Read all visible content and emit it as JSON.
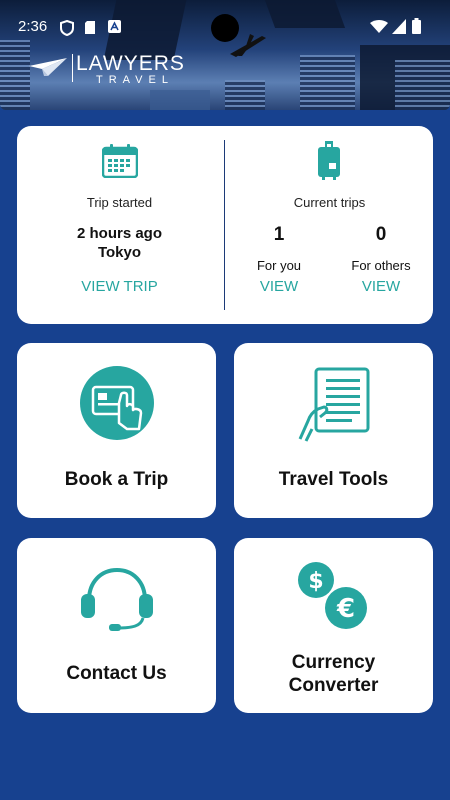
{
  "status_bar": {
    "time": "2:36"
  },
  "brand": {
    "name": "LAWYERS",
    "sub": "TRAVEL"
  },
  "summary": {
    "left": {
      "caption": "Trip started",
      "time": "2 hours ago",
      "city": "Tokyo",
      "action": "VIEW TRIP"
    },
    "right": {
      "caption": "Current trips",
      "you": {
        "count": "1",
        "label": "For you",
        "action": "VIEW"
      },
      "others": {
        "count": "0",
        "label": "For others",
        "action": "VIEW"
      }
    }
  },
  "tiles": {
    "book": {
      "label": "Book a Trip",
      "icon": "card-tap-icon"
    },
    "tools": {
      "label": "Travel Tools",
      "icon": "document-hand-icon"
    },
    "contact": {
      "label": "Contact Us",
      "icon": "headset-icon"
    },
    "currency": {
      "line1": "Currency",
      "line2": "Converter",
      "icon": "currency-icon"
    }
  },
  "colors": {
    "background": "#17418f",
    "accent": "#27a6a0",
    "card": "#ffffff"
  }
}
